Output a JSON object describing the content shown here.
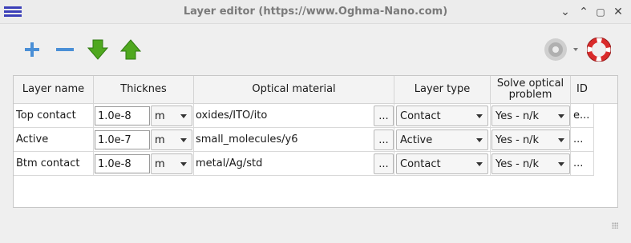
{
  "window": {
    "title": "Layer editor (https://www.Oghma-Nano.com)",
    "controls": {
      "minimize": "⌄",
      "restore": "⌃",
      "maximize": "▢",
      "close": "✕"
    }
  },
  "toolbar": {
    "add_icon": "plus-icon",
    "remove_icon": "minus-icon",
    "move_down_icon": "arrow-down-icon",
    "move_up_icon": "arrow-up-icon",
    "disc_icon": "disc-icon",
    "help_icon": "lifebuoy-icon"
  },
  "table": {
    "columns": [
      "Layer name",
      "Thicknes",
      "Optical material",
      "Layer type",
      "Solve optical problem",
      "ID"
    ],
    "rows": [
      {
        "name": "Top contact",
        "thickness": "1.0e-8",
        "unit": "m",
        "material": "oxides/ITO/ito",
        "browse": "...",
        "layer_type": "Contact",
        "solve": "Yes - n/k",
        "id": "e..."
      },
      {
        "name": "Active",
        "thickness": "1.0e-7",
        "unit": "m",
        "material": "small_molecules/y6",
        "browse": "...",
        "layer_type": "Active",
        "solve": "Yes - n/k",
        "id": "..."
      },
      {
        "name": "Btm contact",
        "thickness": "1.0e-8",
        "unit": "m",
        "material": "metal/Ag/std",
        "browse": "...",
        "layer_type": "Contact",
        "solve": "Yes - n/k",
        "id": "..."
      }
    ]
  },
  "colors": {
    "accent_green": "#4fa81f",
    "accent_blue": "#4a8fd6",
    "help_red": "#d92b2b",
    "menu_blue": "#3b3fb8"
  }
}
